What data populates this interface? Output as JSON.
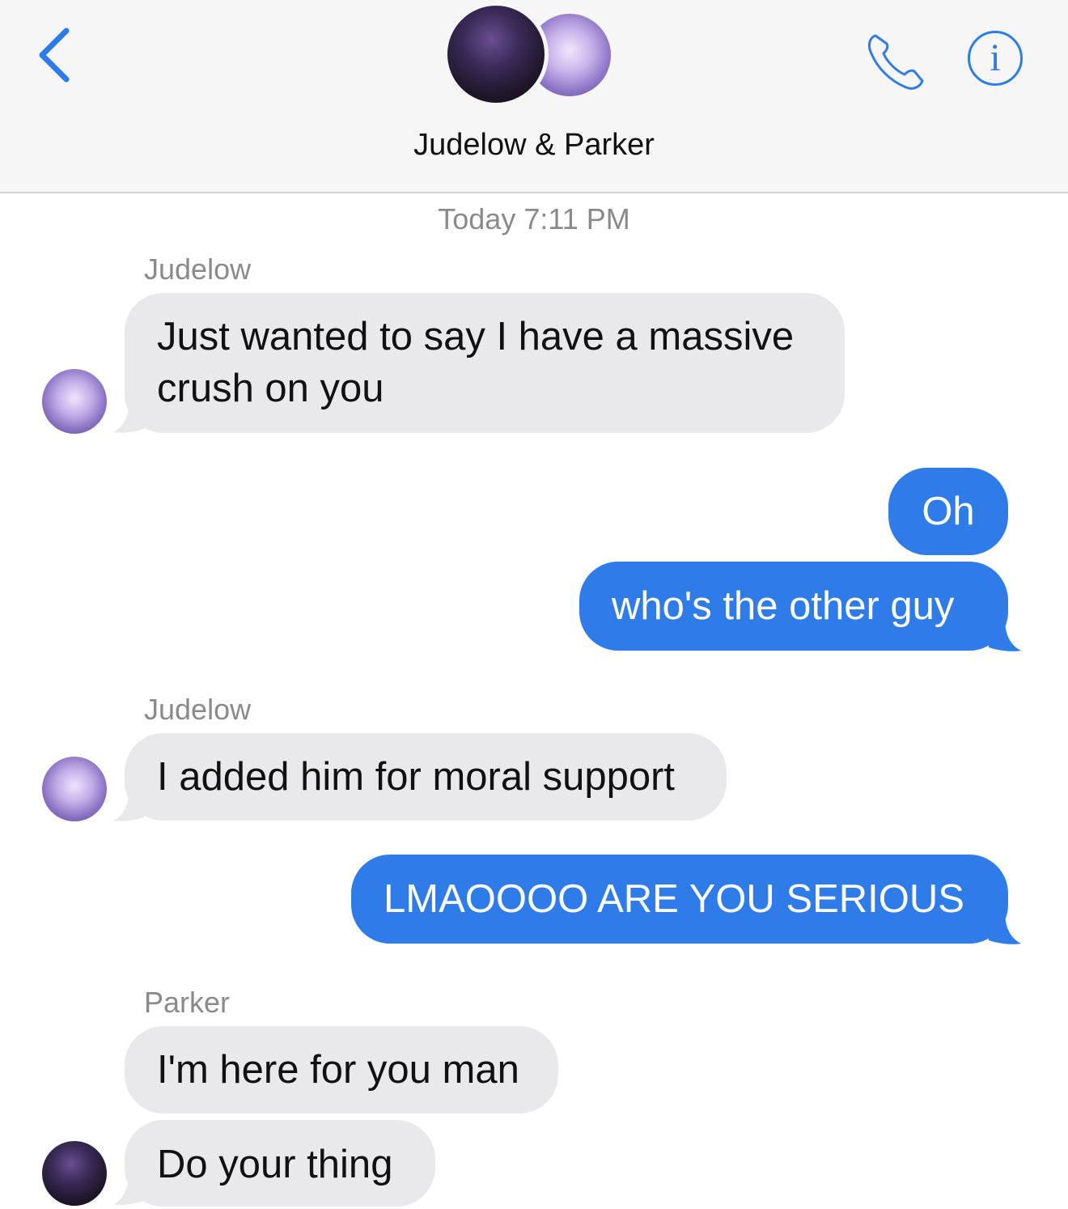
{
  "header": {
    "title": "Judelow & Parker",
    "accent_color": "#2f7be8",
    "back_icon": "chevron-left-icon",
    "call_icon": "phone-icon",
    "info_icon": "info-icon",
    "info_glyph": "i"
  },
  "conversation": {
    "timestamp": "Today 7:11 PM",
    "senders": {
      "judelow_1": "Judelow",
      "judelow_2": "Judelow",
      "parker": "Parker"
    },
    "messages": [
      {
        "from": "Judelow",
        "text_line1": "Just wanted to say I have a massive",
        "text_line2": "crush on you"
      },
      {
        "from": "me",
        "text": "Oh"
      },
      {
        "from": "me",
        "text": "who's the other guy"
      },
      {
        "from": "Judelow",
        "text": "I added him for moral support"
      },
      {
        "from": "me",
        "text": "LMAOOOO ARE YOU SERIOUS"
      },
      {
        "from": "Parker",
        "text": "I'm here for you man"
      },
      {
        "from": "Parker",
        "text": "Do your thing"
      }
    ],
    "incoming_color": "#e9e9eb",
    "outgoing_color": "#2f7be8"
  }
}
